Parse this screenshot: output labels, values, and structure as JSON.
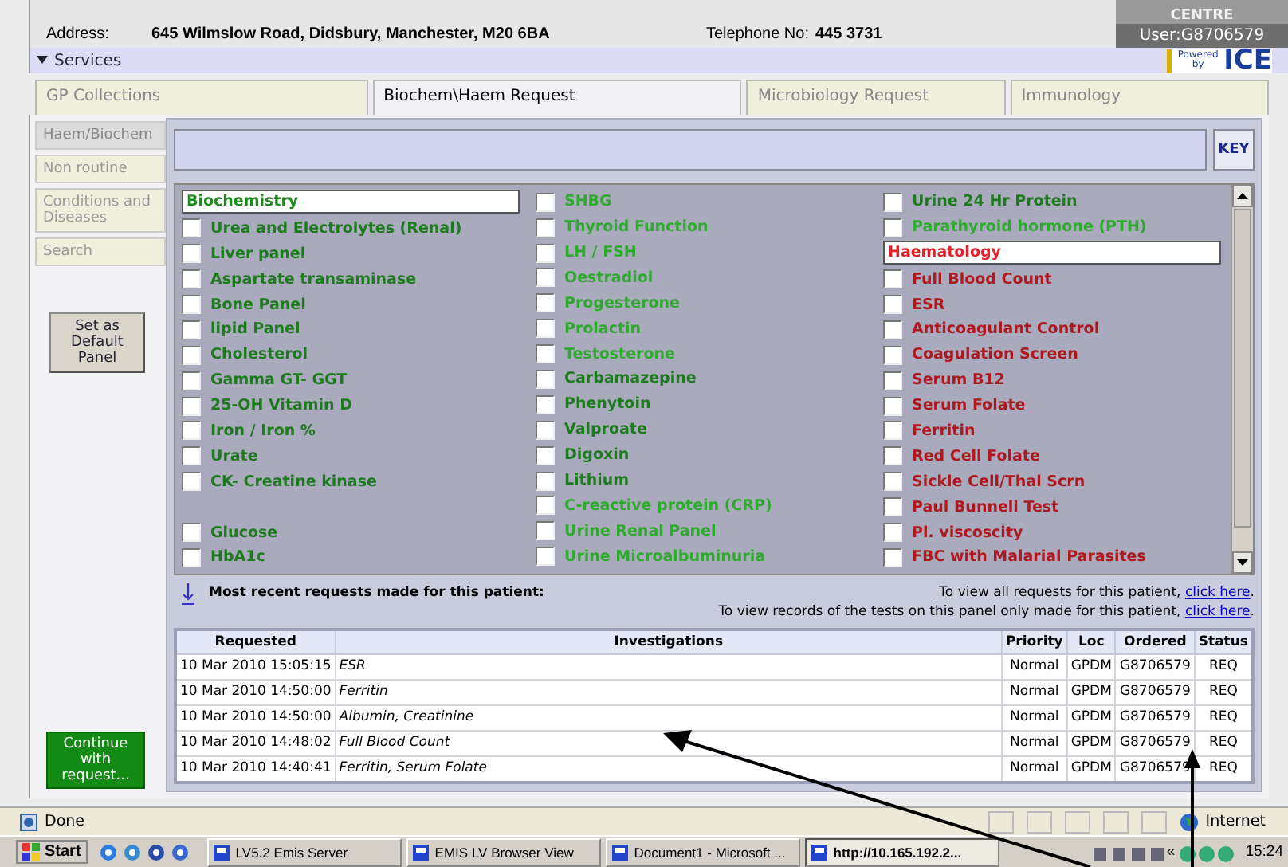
{
  "header": {
    "address_label": "Address:",
    "address": "645 Wilmslow Road, Didsbury, Manchester, M20 6BA",
    "telephone_label": "Telephone No:",
    "telephone": "445 3731",
    "centre": "CENTRE",
    "user": "User:G8706579"
  },
  "services": {
    "label": "Services",
    "expanded": true,
    "logo_top": "Powered by",
    "logo": "ICE"
  },
  "tabs": [
    {
      "label": "GP Collections",
      "selected": false
    },
    {
      "label": "Biochem\\Haem Request",
      "selected": true
    },
    {
      "label": "Microbiology Request",
      "selected": false
    },
    {
      "label": "Immunology",
      "selected": false
    }
  ],
  "sidebar": {
    "items": [
      {
        "label": "Haem/Biochem",
        "selected": true
      },
      {
        "label": "Non routine",
        "selected": false
      },
      {
        "label": "Conditions and Diseases",
        "selected": false
      },
      {
        "label": "Search",
        "selected": false
      }
    ],
    "default_button": "Set as Default Panel",
    "continue_button": "Continue with request..."
  },
  "key_button": "KEY",
  "test_columns": [
    [
      {
        "kind": "heading",
        "label": "Biochemistry",
        "color": "#1e8a1e"
      },
      {
        "kind": "test",
        "label": "Urea and Electrolytes (Renal)",
        "color": "#1e7a1e",
        "checked": false
      },
      {
        "kind": "test",
        "label": "Liver panel",
        "color": "#1e7a1e",
        "checked": false
      },
      {
        "kind": "test",
        "label": "Aspartate transaminase",
        "color": "#1e7a1e",
        "checked": false
      },
      {
        "kind": "test",
        "label": "Bone Panel",
        "color": "#1e7a1e",
        "checked": false
      },
      {
        "kind": "test",
        "label": "lipid Panel",
        "color": "#1e7a1e",
        "checked": false
      },
      {
        "kind": "test",
        "label": "Cholesterol",
        "color": "#1e7a1e",
        "checked": false
      },
      {
        "kind": "test",
        "label": "Gamma GT- GGT",
        "color": "#1e7a1e",
        "checked": false
      },
      {
        "kind": "test",
        "label": "25-OH Vitamin D",
        "color": "#1e7a1e",
        "checked": false
      },
      {
        "kind": "test",
        "label": "Iron / Iron %",
        "color": "#1e7a1e",
        "checked": false
      },
      {
        "kind": "test",
        "label": "Urate",
        "color": "#1e7a1e",
        "checked": false
      },
      {
        "kind": "test",
        "label": "CK- Creatine kinase",
        "color": "#1e7a1e",
        "checked": false
      },
      {
        "kind": "gap"
      },
      {
        "kind": "test",
        "label": "Glucose",
        "color": "#1e7a1e",
        "checked": false
      },
      {
        "kind": "test",
        "label": "HbA1c",
        "color": "#1e7a1e",
        "checked": false
      }
    ],
    [
      {
        "kind": "test",
        "label": "SHBG",
        "color": "#2eaa2e",
        "checked": false
      },
      {
        "kind": "test",
        "label": "Thyroid Function",
        "color": "#2eaa2e",
        "checked": false
      },
      {
        "kind": "test",
        "label": "LH / FSH",
        "color": "#2eaa2e",
        "checked": false
      },
      {
        "kind": "test",
        "label": "Oestradiol",
        "color": "#2eaa2e",
        "checked": false
      },
      {
        "kind": "test",
        "label": "Progesterone",
        "color": "#2eaa2e",
        "checked": false
      },
      {
        "kind": "test",
        "label": "Prolactin",
        "color": "#2eaa2e",
        "checked": false
      },
      {
        "kind": "test",
        "label": "Testosterone",
        "color": "#2eaa2e",
        "checked": false
      },
      {
        "kind": "test",
        "label": "Carbamazepine",
        "color": "#1e7a1e",
        "checked": false
      },
      {
        "kind": "test",
        "label": "Phenytoin",
        "color": "#1e7a1e",
        "checked": false
      },
      {
        "kind": "test",
        "label": "Valproate",
        "color": "#1e7a1e",
        "checked": false
      },
      {
        "kind": "test",
        "label": "Digoxin",
        "color": "#1e7a1e",
        "checked": false
      },
      {
        "kind": "test",
        "label": "Lithium",
        "color": "#1e7a1e",
        "checked": false
      },
      {
        "kind": "test",
        "label": "C-reactive protein (CRP)",
        "color": "#2eaa2e",
        "checked": false
      },
      {
        "kind": "test",
        "label": "Urine Renal Panel",
        "color": "#2eaa2e",
        "checked": false
      },
      {
        "kind": "test",
        "label": "Urine Microalbuminuria",
        "color": "#2eaa2e",
        "checked": false
      }
    ],
    [
      {
        "kind": "test",
        "label": "Urine 24 Hr Protein",
        "color": "#1e7a1e",
        "checked": false
      },
      {
        "kind": "test",
        "label": "Parathyroid hormone (PTH)",
        "color": "#2eaa2e",
        "checked": false
      },
      {
        "kind": "heading",
        "label": "Haematology",
        "color": "#e8202a"
      },
      {
        "kind": "test",
        "label": "Full Blood Count",
        "color": "#b01820",
        "checked": false
      },
      {
        "kind": "test",
        "label": "ESR",
        "color": "#b01820",
        "checked": false
      },
      {
        "kind": "test",
        "label": "Anticoagulant Control",
        "color": "#b01820",
        "checked": false
      },
      {
        "kind": "test",
        "label": "Coagulation Screen",
        "color": "#b01820",
        "checked": false
      },
      {
        "kind": "test",
        "label": "Serum B12",
        "color": "#b01820",
        "checked": false
      },
      {
        "kind": "test",
        "label": "Serum Folate",
        "color": "#b01820",
        "checked": false
      },
      {
        "kind": "test",
        "label": "Ferritin",
        "color": "#b01820",
        "checked": false
      },
      {
        "kind": "test",
        "label": "Red Cell Folate",
        "color": "#b01820",
        "checked": false
      },
      {
        "kind": "test",
        "label": "Sickle Cell/Thal Scrn",
        "color": "#b01820",
        "checked": false
      },
      {
        "kind": "test",
        "label": "Paul Bunnell Test",
        "color": "#b01820",
        "checked": false
      },
      {
        "kind": "test",
        "label": "Pl. viscoscity",
        "color": "#b01820",
        "checked": false
      },
      {
        "kind": "test",
        "label": "FBC with Malarial Parasites",
        "color": "#b01820",
        "checked": false
      }
    ]
  ],
  "recent": {
    "title": "Most recent requests made for this patient:",
    "links": [
      {
        "text": "To view all requests for this patient,",
        "link": "click here",
        "end": "."
      },
      {
        "text": "To view records of the tests on this panel only made for this patient,",
        "link": "click here",
        "end": "."
      }
    ]
  },
  "table": {
    "columns": [
      "Requested",
      "Investigations",
      "Priority",
      "Loc",
      "Ordered",
      "Status"
    ],
    "rows": [
      [
        "10 Mar 2010 15:05:15",
        "ESR",
        "Normal",
        "GPDM",
        "G8706579",
        "REQ"
      ],
      [
        "10 Mar 2010 14:50:00",
        "Ferritin",
        "Normal",
        "GPDM",
        "G8706579",
        "REQ"
      ],
      [
        "10 Mar 2010 14:50:00",
        "Albumin, Creatinine",
        "Normal",
        "GPDM",
        "G8706579",
        "REQ"
      ],
      [
        "10 Mar 2010 14:48:02",
        "Full Blood Count",
        "Normal",
        "GPDM",
        "G8706579",
        "REQ"
      ],
      [
        "10 Mar 2010 14:40:41",
        "Ferritin, Serum Folate",
        "Normal",
        "GPDM",
        "G8706579",
        "REQ"
      ]
    ]
  },
  "status_bar": {
    "status": "Done",
    "zone": "Internet"
  },
  "taskbar": {
    "start": "Start",
    "tasks": [
      {
        "label": "LV5.2 Emis Server",
        "selected": false
      },
      {
        "label": "EMIS LV Browser View",
        "selected": false
      },
      {
        "label": "Document1 - Microsoft ...",
        "selected": false
      },
      {
        "label": "http://10.165.192.2...",
        "selected": true
      }
    ],
    "tray_toggle": "«",
    "clock": "15:24"
  }
}
